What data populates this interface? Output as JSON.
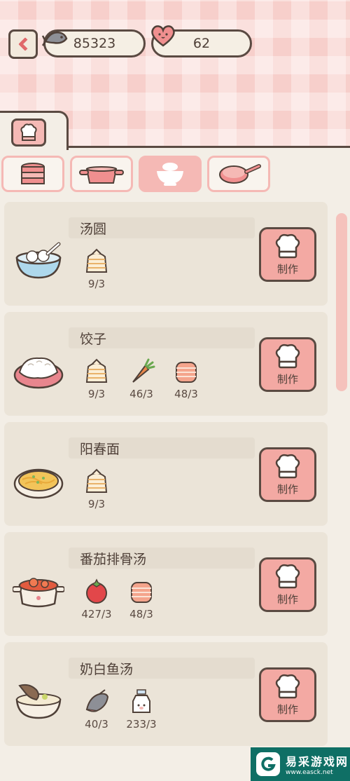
{
  "header": {
    "fish_count": "85323",
    "heart_count": "62"
  },
  "tabs": {
    "active_tab_icon": "chef-book-icon"
  },
  "categories": [
    {
      "icon": "steamer-icon",
      "active": false
    },
    {
      "icon": "pot-icon",
      "active": false
    },
    {
      "icon": "bowl-icon",
      "active": true
    },
    {
      "icon": "pan-icon",
      "active": false
    }
  ],
  "recipes": [
    {
      "name": "汤圆",
      "dish": "tangyuan-bowl",
      "ingredients": [
        {
          "icon": "flour-bag-icon",
          "count": "9/3"
        }
      ],
      "button": "制作"
    },
    {
      "name": "饺子",
      "dish": "dumpling-plate",
      "ingredients": [
        {
          "icon": "flour-bag-icon",
          "count": "9/3"
        },
        {
          "icon": "carrot-icon",
          "count": "46/3"
        },
        {
          "icon": "meat-icon",
          "count": "48/3"
        }
      ],
      "button": "制作"
    },
    {
      "name": "阳春面",
      "dish": "noodle-bowl",
      "ingredients": [
        {
          "icon": "flour-bag-icon",
          "count": "9/3"
        }
      ],
      "button": "制作"
    },
    {
      "name": "番茄排骨汤",
      "dish": "tomato-soup-pot",
      "ingredients": [
        {
          "icon": "tomato-icon",
          "count": "427/3"
        },
        {
          "icon": "meat-icon",
          "count": "48/3"
        }
      ],
      "button": "制作"
    },
    {
      "name": "奶白鱼汤",
      "dish": "fish-soup-bowl",
      "ingredients": [
        {
          "icon": "fish-icon",
          "count": "40/3"
        },
        {
          "icon": "milk-bottle-icon",
          "count": "233/3"
        }
      ],
      "button": "制作"
    }
  ],
  "watermark": {
    "title": "易采游戏网",
    "url": "www.easck.net"
  },
  "colors": {
    "accent": "#f3a9a3",
    "outline": "#5a4a42",
    "card": "#ebe4d8"
  }
}
